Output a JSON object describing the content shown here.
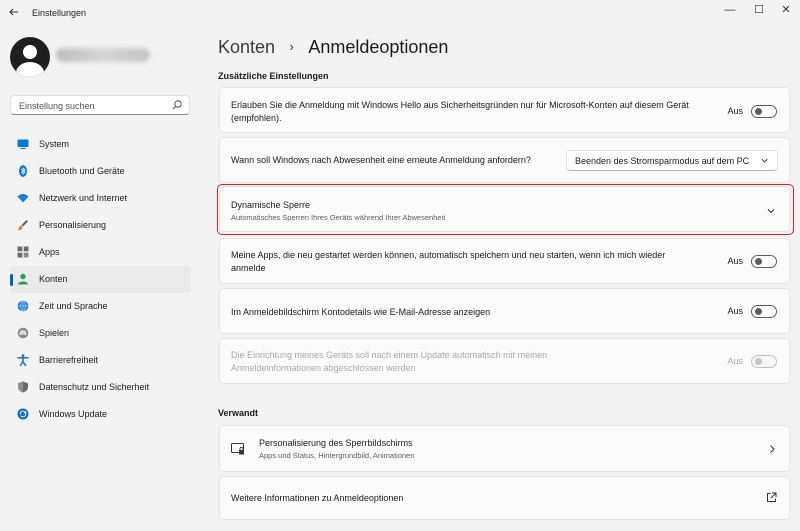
{
  "window": {
    "title": "Einstellungen",
    "back_icon": "arrow-left-icon",
    "minimize_glyph": "—",
    "maximize_glyph": "☐",
    "close_glyph": "✕"
  },
  "sidebar": {
    "search": {
      "placeholder": "Einstellung suchen"
    },
    "items": [
      {
        "label": "System",
        "icon": "monitor-icon",
        "color": "#0078d4"
      },
      {
        "label": "Bluetooth und Geräte",
        "icon": "bluetooth-icon",
        "color": "#0078d4"
      },
      {
        "label": "Netzwerk und Internet",
        "icon": "wifi-icon",
        "color": "#1a7bd1"
      },
      {
        "label": "Personalisierung",
        "icon": "brush-icon",
        "color": "#d47b28"
      },
      {
        "label": "Apps",
        "icon": "apps-icon",
        "color": "#6b6b6b"
      },
      {
        "label": "Konten",
        "icon": "person-icon",
        "color": "#2e9b5e",
        "active": true
      },
      {
        "label": "Zeit und Sprache",
        "icon": "globe-clock-icon",
        "color": "#1a7bd1"
      },
      {
        "label": "Spielen",
        "icon": "gamepad-icon",
        "color": "#7a7a7a"
      },
      {
        "label": "Barrierefreiheit",
        "icon": "accessibility-icon",
        "color": "#1a6fc2"
      },
      {
        "label": "Datenschutz und Sicherheit",
        "icon": "shield-icon",
        "color": "#6b6b6b"
      },
      {
        "label": "Windows Update",
        "icon": "update-icon",
        "color": "#0f6cbd"
      }
    ]
  },
  "breadcrumb": {
    "parent": "Konten",
    "separator": "›",
    "current": "Anmeldeoptionen"
  },
  "sections": {
    "additional": "Zusätzliche Einstellungen",
    "related": "Verwandt"
  },
  "settings": {
    "hello_only": {
      "text": "Erlauben Sie die Anmeldung mit Windows Hello aus Sicherheitsgründen nur für Microsoft-Konten auf diesem Gerät (empfohlen).",
      "state": "Aus"
    },
    "require_signin": {
      "text": "Wann soll Windows nach Abwesenheit eine erneute Anmeldung anfordern?",
      "selected": "Beenden des Stromsparmodus auf dem PC"
    },
    "dynamic_lock": {
      "title": "Dynamische Sperre",
      "subtitle": "Automatisches Sperren Ihres Geräts während Ihrer Abwesenheit"
    },
    "restart_apps": {
      "text": "Meine Apps, die neu gestartet werden können, automatisch speichern und neu starten, wenn ich mich wieder anmelde",
      "state": "Aus"
    },
    "account_details": {
      "text": "Im Anmeldebildschirm Kontodetails wie E-Mail-Adresse anzeigen",
      "state": "Aus"
    },
    "auto_finish": {
      "text": "Die Einrichtung meines Geräts soll nach einem Update automatisch mit meinen Anmeldeinformationen abgeschlossen werden",
      "state": "Aus",
      "disabled": true
    }
  },
  "related": {
    "lockscreen": {
      "title": "Personalisierung des Sperrbildschirms",
      "subtitle": "Apps und Status, Hintergrundbild, Animationen"
    },
    "more_info": {
      "title": "Weitere Informationen zu Anmeldeoptionen"
    }
  },
  "colors": {
    "accent": "#005fb8",
    "highlight": "#d9232e"
  }
}
